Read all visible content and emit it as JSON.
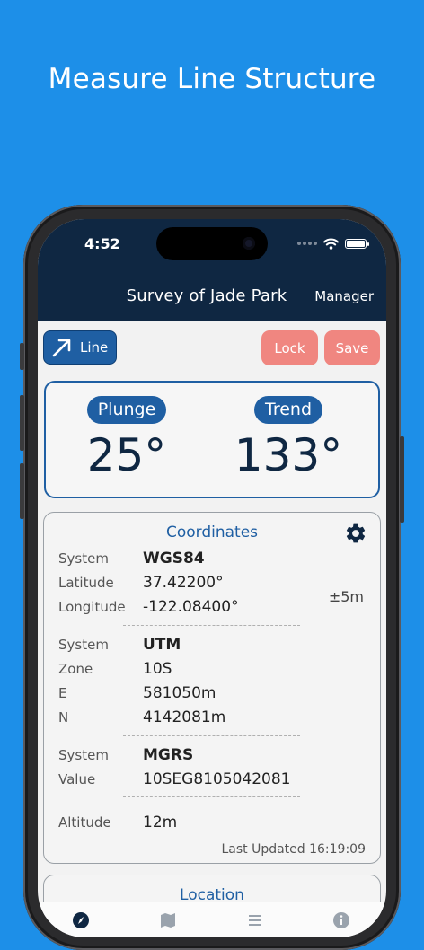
{
  "headline": "Measure Line Structure",
  "status": {
    "time": "4:52"
  },
  "nav": {
    "title": "Survey of Jade Park",
    "manager": "Manager"
  },
  "toolbar": {
    "line": "Line",
    "lock": "Lock",
    "save": "Save"
  },
  "measure": {
    "plunge_label": "Plunge",
    "plunge_value": "25°",
    "trend_label": "Trend",
    "trend_value": "133°"
  },
  "coordinates": {
    "title": "Coordinates",
    "accuracy": "±5m",
    "wgs": {
      "system_label": "System",
      "system": "WGS84",
      "lat_label": "Latitude",
      "lat": "37.42200°",
      "lon_label": "Longitude",
      "lon": "-122.08400°"
    },
    "utm": {
      "system_label": "System",
      "system": "UTM",
      "zone_label": "Zone",
      "zone": "10S",
      "e_label": "E",
      "e": "581050m",
      "n_label": "N",
      "n": "4142081m"
    },
    "mgrs": {
      "system_label": "System",
      "system": "MGRS",
      "value_label": "Value",
      "value": "10SEG8105042081"
    },
    "altitude_label": "Altitude",
    "altitude": "12m",
    "updated": "Last Updated 16:19:09"
  },
  "location": {
    "title": "Location"
  },
  "colors": {
    "background": "#1d8fe8",
    "navbar": "#0f2742",
    "accent": "#1f5fa3",
    "danger": "#f08680"
  },
  "icons": [
    "arrow-up-right-icon",
    "gear-icon",
    "compass-icon",
    "map-icon",
    "list-icon",
    "info-icon",
    "wifi-icon",
    "battery-icon"
  ]
}
